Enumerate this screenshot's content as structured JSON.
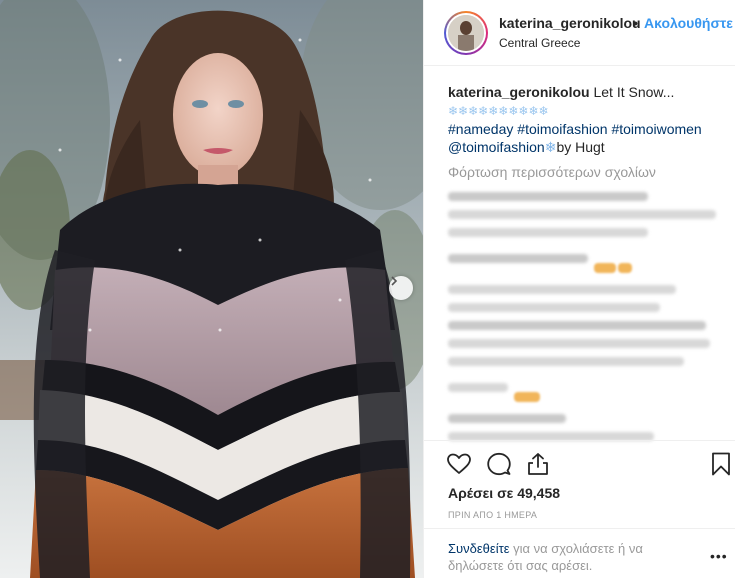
{
  "header": {
    "username": "katerina_geronikolou",
    "separator": "•",
    "follow_label": "Ακολουθήστε",
    "location": "Central Greece"
  },
  "caption": {
    "username": "katerina_geronikolou",
    "text": "Let It Snow...",
    "snow_emojis": "❄❄❄❄❄❄❄❄❄❄",
    "hashtags": [
      "#nameday",
      "#toimoifashion",
      "#toimoiwomen"
    ],
    "mention": "@toimoifashion",
    "flake": "❄",
    "by_text": "by Hugt"
  },
  "comments": {
    "load_more": "Φόρτωση περισσότερων σχολίων"
  },
  "actions": {
    "like_icon": "heart-icon",
    "comment_icon": "comment-icon",
    "share_icon": "share-icon",
    "save_icon": "bookmark-icon"
  },
  "stats": {
    "likes": "Αρέσει σε 49,458",
    "time_ago": "ΠΡΙΝ ΑΠΟ 1 ΗΜΕΡΑ"
  },
  "footer": {
    "login_link": "Συνδεθείτε",
    "text": " για να σχολιάσετε ή να δηλώσετε ότι σας αρέσει.",
    "more": "•••"
  },
  "colors": {
    "link": "#3897f0",
    "hashtag": "#003569",
    "muted": "#999999",
    "text": "#262626"
  }
}
